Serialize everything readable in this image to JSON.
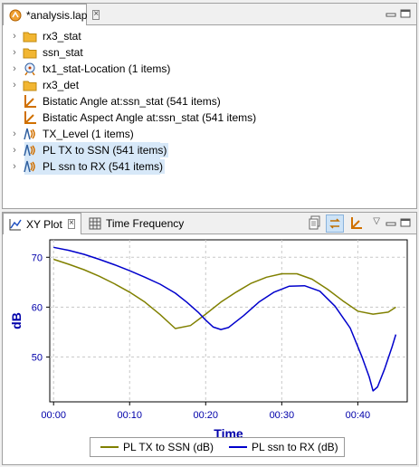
{
  "top_tab": {
    "title": "*analysis.lap"
  },
  "tree": {
    "items": [
      {
        "label": "rx3_stat",
        "icon": "folder-icon",
        "expanded": false,
        "selected": false
      },
      {
        "label": "ssn_stat",
        "icon": "folder-icon",
        "expanded": false,
        "selected": false
      },
      {
        "label": "tx1_stat-Location (1 items)",
        "icon": "location-icon",
        "expanded": false,
        "selected": false
      },
      {
        "label": "rx3_det",
        "icon": "folder-icon",
        "expanded": false,
        "selected": false
      },
      {
        "label": "Bistatic Angle at:ssn_stat (541 items)",
        "icon": "angle-icon",
        "expanded": null,
        "selected": false
      },
      {
        "label": "Bistatic Aspect Angle at:ssn_stat (541 items)",
        "icon": "angle-icon",
        "expanded": null,
        "selected": false
      },
      {
        "label": "TX_Level (1 items)",
        "icon": "signal-icon",
        "expanded": false,
        "selected": false
      },
      {
        "label": "PL TX to SSN (541 items)",
        "icon": "signal-icon",
        "expanded": false,
        "selected": true
      },
      {
        "label": "PL ssn to RX (541 items)",
        "icon": "signal-icon",
        "expanded": false,
        "selected": true
      }
    ]
  },
  "bottom_tabs": [
    {
      "label": "XY Plot",
      "icon": "xy-plot-icon"
    },
    {
      "label": "Time Frequency",
      "icon": "time-frequency-icon"
    }
  ],
  "chart_data": {
    "type": "line",
    "title": "",
    "xlabel": "Time",
    "ylabel": "dB",
    "x_tick_labels": [
      "00:00",
      "00:10",
      "00:20",
      "00:30",
      "00:40"
    ],
    "y_tick_labels": [
      "50",
      "60",
      "70"
    ],
    "xlim": [
      -0.5,
      46.5
    ],
    "ylim": [
      41,
      73.5
    ],
    "grid": true,
    "legend_position": "bottom",
    "series": [
      {
        "name": "PL TX to SSN (dB)",
        "color": "#808000",
        "x": [
          0,
          2,
          4,
          6,
          8,
          10,
          12,
          14,
          16,
          18,
          20,
          22,
          24,
          26,
          28,
          30,
          32,
          34,
          36,
          38,
          40,
          42,
          44,
          45
        ],
        "y": [
          69.6,
          68.6,
          67.5,
          66.2,
          64.7,
          63.0,
          61.0,
          58.5,
          55.7,
          56.3,
          58.6,
          61.0,
          63.0,
          64.8,
          66.0,
          66.7,
          66.7,
          65.6,
          63.6,
          61.3,
          59.2,
          58.6,
          59.0,
          60.0
        ]
      },
      {
        "name": "PL ssn to RX (dB)",
        "color": "#0000cc",
        "x": [
          0,
          2,
          4,
          6,
          8,
          10,
          12,
          14,
          16,
          17.5,
          19,
          20,
          21,
          22,
          23,
          25,
          27,
          29,
          31,
          33,
          35,
          37,
          39,
          40.5,
          41.5,
          42,
          42.6,
          43.5,
          44.5,
          45
        ],
        "y": [
          72.0,
          71.4,
          70.6,
          69.6,
          68.5,
          67.3,
          66.0,
          64.6,
          62.8,
          61.0,
          59.0,
          57.4,
          56.0,
          55.5,
          55.9,
          58.3,
          61.0,
          63.0,
          64.2,
          64.3,
          63.2,
          60.2,
          55.8,
          50.2,
          46.0,
          43.2,
          44.0,
          47.5,
          52.0,
          54.5
        ]
      }
    ]
  }
}
